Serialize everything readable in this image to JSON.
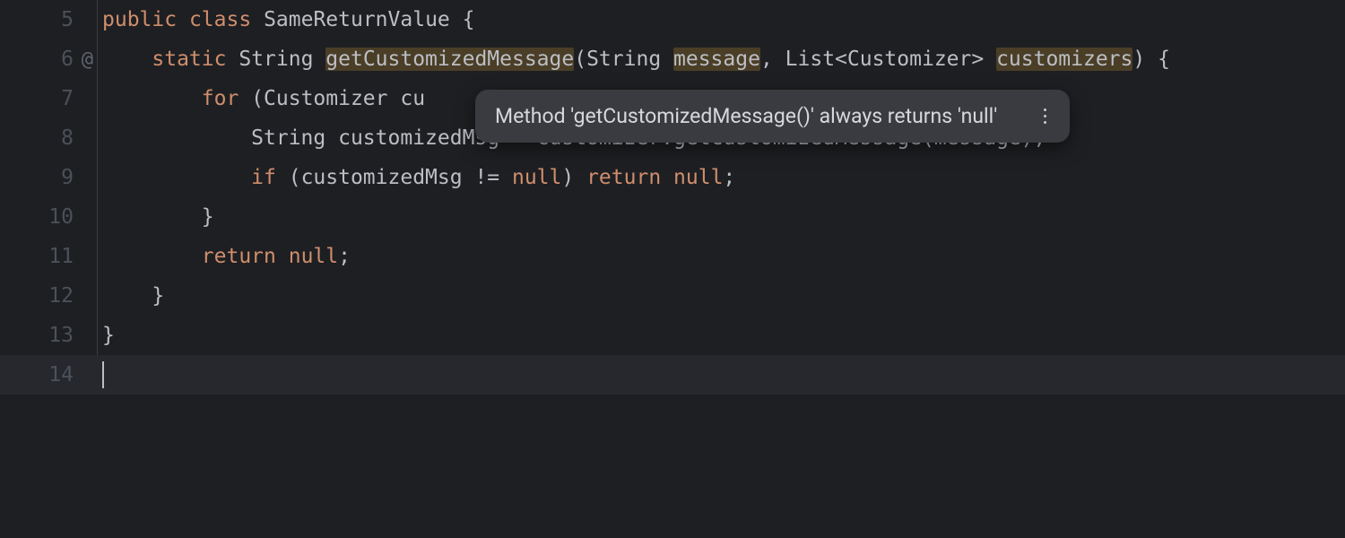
{
  "gutter": {
    "l5": "5",
    "l6": "6",
    "l6mark": "@",
    "l7": "7",
    "l8": "8",
    "l9": "9",
    "l10": "10",
    "l11": "11",
    "l12": "12",
    "l13": "13",
    "l14": "14"
  },
  "code": {
    "l5": {
      "public": "public",
      "sp1": " ",
      "class": "class",
      "sp2": " ",
      "name": "SameReturnValue",
      "rest": " {"
    },
    "l6": {
      "indent": "    ",
      "static": "static",
      "sp1": " ",
      "type": "String ",
      "method": "getCustomizedMessage",
      "open": "(String ",
      "p1": "message",
      "mid": ", List<Customizer> ",
      "p2": "customizers",
      "close": ") {"
    },
    "l7": {
      "indent": "        ",
      "for": "for",
      "rest": " (Customizer cu"
    },
    "l8": {
      "indent": "            ",
      "text": "String customizedMsg = customizer.getCustomizedMessage(message);"
    },
    "l9": {
      "indent": "            ",
      "if": "if",
      "open": " (customizedMsg != ",
      "null1": "null",
      "mid": ") ",
      "return": "return",
      "sp": " ",
      "null2": "null",
      "semi": ";"
    },
    "l10": "        }",
    "l11": {
      "indent": "        ",
      "return": "return",
      "sp": " ",
      "null": "null",
      "semi": ";"
    },
    "l12": "    }",
    "l13": "}"
  },
  "tooltip": {
    "text": "Method 'getCustomizedMessage()' always returns 'null'"
  }
}
